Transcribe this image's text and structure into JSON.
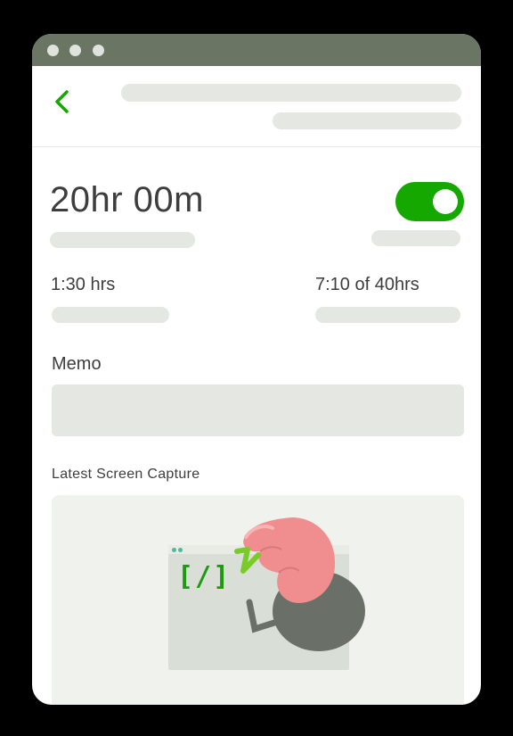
{
  "window": {
    "controls": [
      "window-dot",
      "window-dot",
      "window-dot"
    ]
  },
  "header": {
    "back_icon": "chevron-left-icon"
  },
  "timer": {
    "duration": "20hr 00m",
    "toggle_on": true
  },
  "stats": {
    "left": "1:30 hrs",
    "right": "7:10 of 40hrs"
  },
  "memo": {
    "label": "Memo",
    "value": ""
  },
  "capture": {
    "label": "Latest Screen Capture",
    "glyph": "[/]"
  },
  "colors": {
    "titlebar": "#6b7563",
    "accent": "#14a800",
    "skeleton": "#e4e7e2",
    "text": "#3d3d3d"
  }
}
